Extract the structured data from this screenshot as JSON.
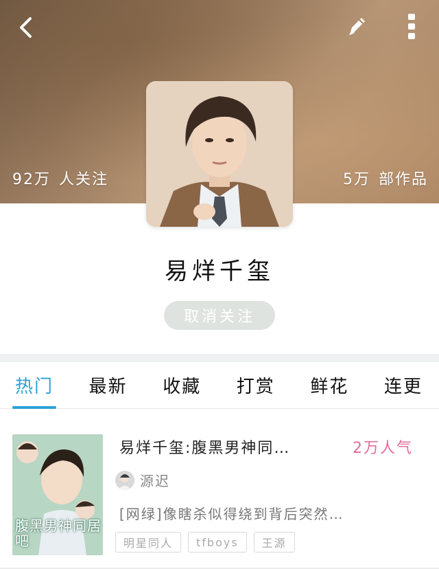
{
  "header": {
    "back_icon": "back-chevron-icon",
    "edit_icon": "pencil-icon",
    "more_icon": "more-vertical-icon",
    "followers": {
      "count": "92万",
      "label": "人关注"
    },
    "works": {
      "count": "5万",
      "label": "部作品"
    }
  },
  "profile": {
    "name": "易烊千玺",
    "follow_button": "取消关注"
  },
  "tabs": [
    {
      "label": "热门"
    },
    {
      "label": "最新"
    },
    {
      "label": "收藏"
    },
    {
      "label": "打赏"
    },
    {
      "label": "鲜花"
    },
    {
      "label": "连更"
    }
  ],
  "book": {
    "title": "易烊千玺:腹黑男神同…",
    "popularity": "2万人气",
    "author": "源迟",
    "description": "[网绿]像瞎杀似得绕到背后突然…",
    "cover_text": "腹黑男神同居吧",
    "tags": [
      "明星同人",
      "tfboys",
      "王源"
    ]
  },
  "colors": {
    "accent": "#2aa2d8",
    "popularity": "#e36c9b",
    "follow_button_bg": "#dfe3e0"
  }
}
